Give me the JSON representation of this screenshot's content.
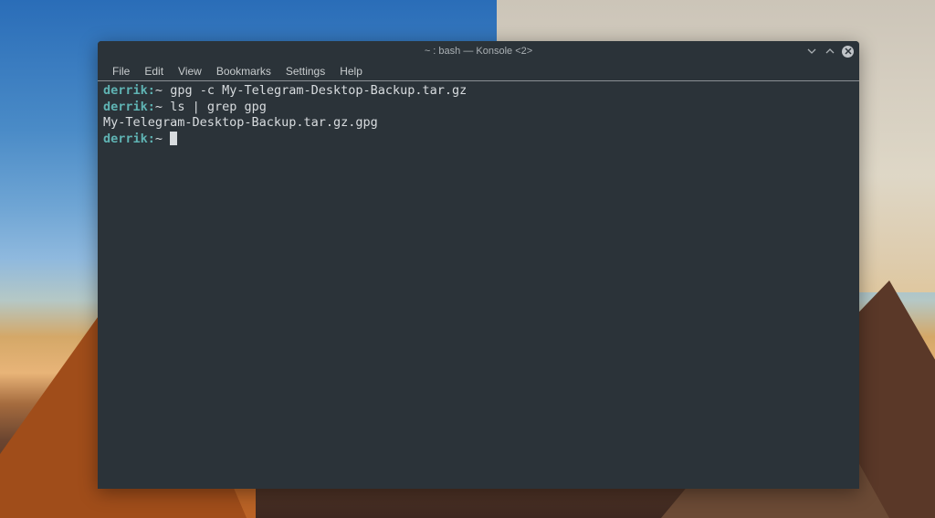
{
  "window": {
    "title": "~ : bash — Konsole <2>"
  },
  "menubar": {
    "items": [
      "File",
      "Edit",
      "View",
      "Bookmarks",
      "Settings",
      "Help"
    ]
  },
  "terminal": {
    "prompt_user": "derrik",
    "prompt_sep": ":",
    "prompt_path": "~",
    "lines": [
      {
        "type": "cmd",
        "command": "gpg -c My-Telegram-Desktop-Backup.tar.gz"
      },
      {
        "type": "cmd",
        "command": "ls | grep gpg"
      },
      {
        "type": "output",
        "text": "My-Telegram-Desktop-Backup.tar.gz.gpg"
      },
      {
        "type": "prompt_cursor"
      }
    ]
  }
}
